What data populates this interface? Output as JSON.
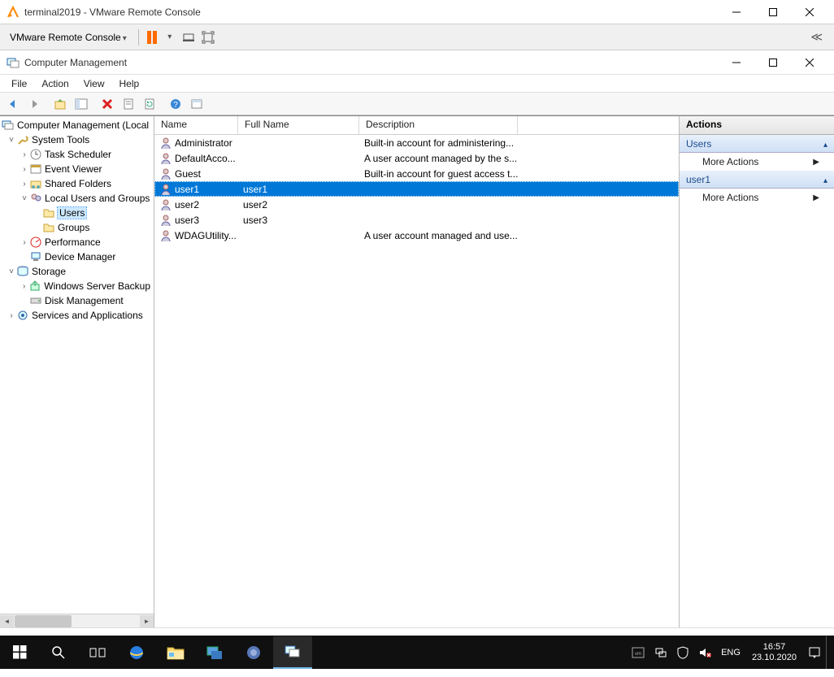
{
  "vmware": {
    "title": "terminal2019 - VMware Remote Console",
    "menu_label": "VMware Remote Console"
  },
  "cm": {
    "title": "Computer Management",
    "menus": {
      "file": "File",
      "action": "Action",
      "view": "View",
      "help": "Help"
    }
  },
  "tree": {
    "root": "Computer Management (Local",
    "system_tools": "System Tools",
    "task_scheduler": "Task Scheduler",
    "event_viewer": "Event Viewer",
    "shared_folders": "Shared Folders",
    "local_users": "Local Users and Groups",
    "users": "Users",
    "groups": "Groups",
    "performance": "Performance",
    "device_manager": "Device Manager",
    "storage": "Storage",
    "ws_backup": "Windows Server Backup",
    "disk_mgmt": "Disk Management",
    "services_apps": "Services and Applications"
  },
  "list": {
    "headers": {
      "name": "Name",
      "fullname": "Full Name",
      "description": "Description"
    },
    "col_widths": {
      "name": 103,
      "fullname": 149,
      "description": 195
    },
    "rows": [
      {
        "name": "Administrator",
        "fullname": "",
        "description": "Built-in account for administering...",
        "sel": false
      },
      {
        "name": "DefaultAcco...",
        "fullname": "",
        "description": "A user account managed by the s...",
        "sel": false
      },
      {
        "name": "Guest",
        "fullname": "",
        "description": "Built-in account for guest access t...",
        "sel": false
      },
      {
        "name": "user1",
        "fullname": "user1",
        "description": "",
        "sel": true
      },
      {
        "name": "user2",
        "fullname": "user2",
        "description": "",
        "sel": false
      },
      {
        "name": "user3",
        "fullname": "user3",
        "description": "",
        "sel": false
      },
      {
        "name": "WDAGUtility...",
        "fullname": "",
        "description": "A user account managed and use...",
        "sel": false
      }
    ]
  },
  "actions": {
    "header": "Actions",
    "section1": "Users",
    "more1": "More Actions",
    "section2": "user1",
    "more2": "More Actions"
  },
  "taskbar": {
    "lang": "ENG",
    "time": "16:57",
    "date": "23.10.2020"
  }
}
